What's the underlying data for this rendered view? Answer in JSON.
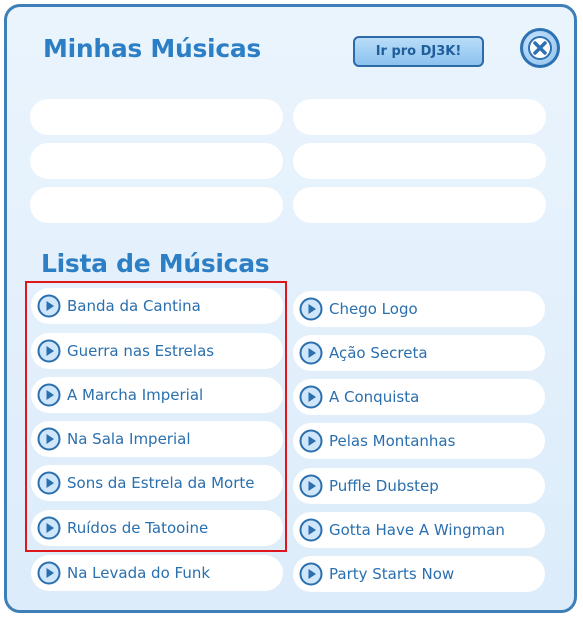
{
  "panel": {
    "title": "Minhas Músicas",
    "dj_button_label": "Ir pro DJ3K!",
    "list_title": "Lista de Músicas"
  },
  "playlist_slots": [
    "",
    "",
    "",
    "",
    "",
    ""
  ],
  "tracks_left": [
    "Banda da Cantina",
    "Guerra nas Estrelas",
    "A Marcha Imperial",
    "Na Sala Imperial",
    "Sons da Estrela da Morte",
    "Ruídos de Tatooine",
    "Na Levada do Funk"
  ],
  "tracks_right": [
    "Chego Logo",
    "Ação Secreta",
    "A Conquista",
    "Pelas Montanhas",
    "Puffle Dubstep",
    "Gotta Have A Wingman",
    "Party Starts Now"
  ],
  "colors": {
    "accent": "#2c7fc4",
    "panel_bg": "#e3f0fc",
    "highlight": "#e0161d"
  }
}
